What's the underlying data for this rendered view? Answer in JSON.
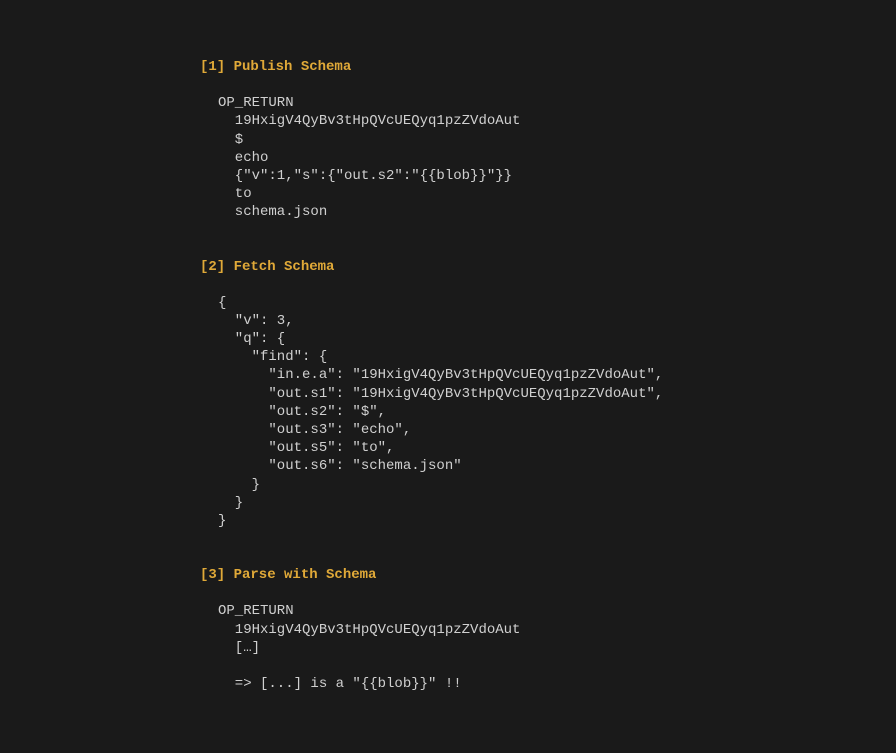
{
  "sections": [
    {
      "heading": "[1] Publish Schema",
      "code": "OP_RETURN\n  19HxigV4QyBv3tHpQVcUEQyq1pzZVdoAut\n  $\n  echo\n  {\"v\":1,\"s\":{\"out.s2\":\"{{blob}}\"}}\n  to\n  schema.json"
    },
    {
      "heading": "[2] Fetch Schema",
      "code": "{\n  \"v\": 3,\n  \"q\": {\n    \"find\": {\n      \"in.e.a\": \"19HxigV4QyBv3tHpQVcUEQyq1pzZVdoAut\",\n      \"out.s1\": \"19HxigV4QyBv3tHpQVcUEQyq1pzZVdoAut\",\n      \"out.s2\": \"$\",\n      \"out.s3\": \"echo\",\n      \"out.s5\": \"to\",\n      \"out.s6\": \"schema.json\"\n    }\n  }\n}"
    },
    {
      "heading": "[3] Parse with Schema",
      "code": "OP_RETURN\n  19HxigV4QyBv3tHpQVcUEQyq1pzZVdoAut\n  […]\n\n  => [...] is a \"{{blob}}\" !!"
    }
  ]
}
